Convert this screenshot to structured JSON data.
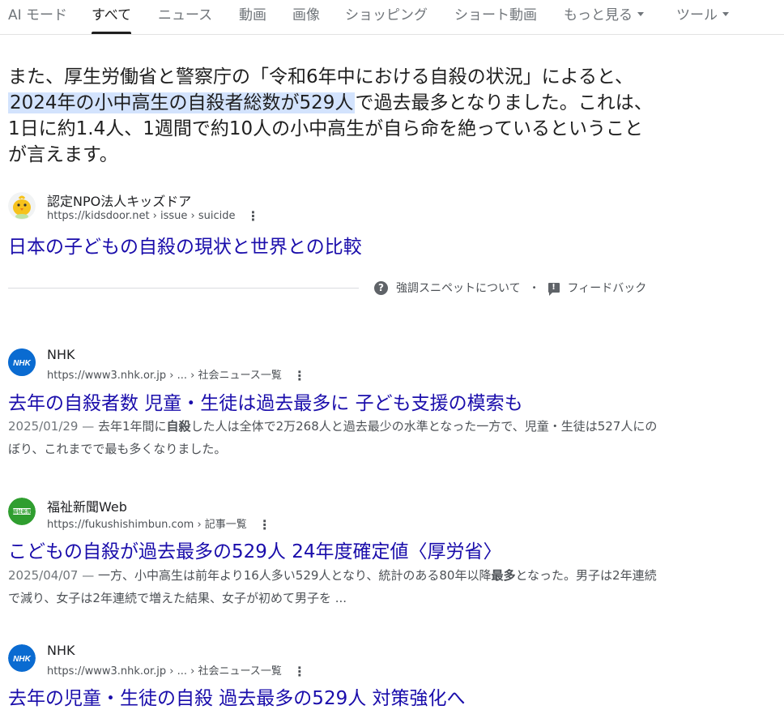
{
  "tabs": [
    {
      "label": "AI モード"
    },
    {
      "label": "すべて"
    },
    {
      "label": "ニュース"
    },
    {
      "label": "動画"
    },
    {
      "label": "画像"
    },
    {
      "label": "ショッピング"
    },
    {
      "label": "ショート動画"
    },
    {
      "label": "もっと見る"
    },
    {
      "label": "ツール"
    }
  ],
  "snippet": {
    "before": "また、厚生労働省と警察庁の「令和6年中における自殺の状況」によると、",
    "highlight": "2024年の小中高生の自殺者総数が529人",
    "after": "で過去最多となりました。これは、1日に約1.4人、1週間で約10人の小中高生が自ら命を絶っているということが言えます。"
  },
  "featured_source": {
    "name": "認定NPO法人キッズドア",
    "url": "https://kidsdoor.net › issue › suicide",
    "title": "日本の子どもの自殺の現状と世界との比較"
  },
  "feedback": {
    "about_label": "強調スニペットについて",
    "separator": "•",
    "feedback_label": "フィードバック",
    "about_icon": "?",
    "feedback_icon": "!"
  },
  "results": [
    {
      "source": "NHK",
      "favicon_text": "NHK",
      "url": "https://www3.nhk.or.jp › ... › 社会ニュース一覧",
      "title": "去年の自殺者数 児童・生徒は過去最多に 子ども支援の模索も",
      "date": "2025/01/29 — ",
      "desc_pre": "去年1年間に",
      "desc_bold": "自殺",
      "desc_post": "した人は全体で2万268人と過去最少の水準となった一方で、児童・生徒は527人にのぼり、これまでで最も多くなりました。"
    },
    {
      "source": "福祉新聞Web",
      "favicon_text": "福祉新聞",
      "url": "https://fukushishimbun.com › 記事一覧",
      "title": "こどもの自殺が過去最多の529人 24年度確定値〈厚労省〉",
      "date": "2025/04/07 — ",
      "desc_pre": "一方、小中高生は前年より16人多い529人となり、統計のある80年以降",
      "desc_bold": "最多",
      "desc_post": "となった。男子は2年連続で減り、女子は2年連続で増えた結果、女子が初めて男子を ..."
    },
    {
      "source": "NHK",
      "favicon_text": "NHK",
      "url": "https://www3.nhk.or.jp › ... › 社会ニュース一覧",
      "title": "去年の児童・生徒の自殺 過去最多の529人 対策強化へ"
    }
  ],
  "kebab_symbol": "⋮",
  "colors": {
    "link": "#1a0dab",
    "highlight": "#d3e3fd",
    "nhk_blue": "#0a6bd1",
    "fukushi_green": "#2f9e2f"
  }
}
